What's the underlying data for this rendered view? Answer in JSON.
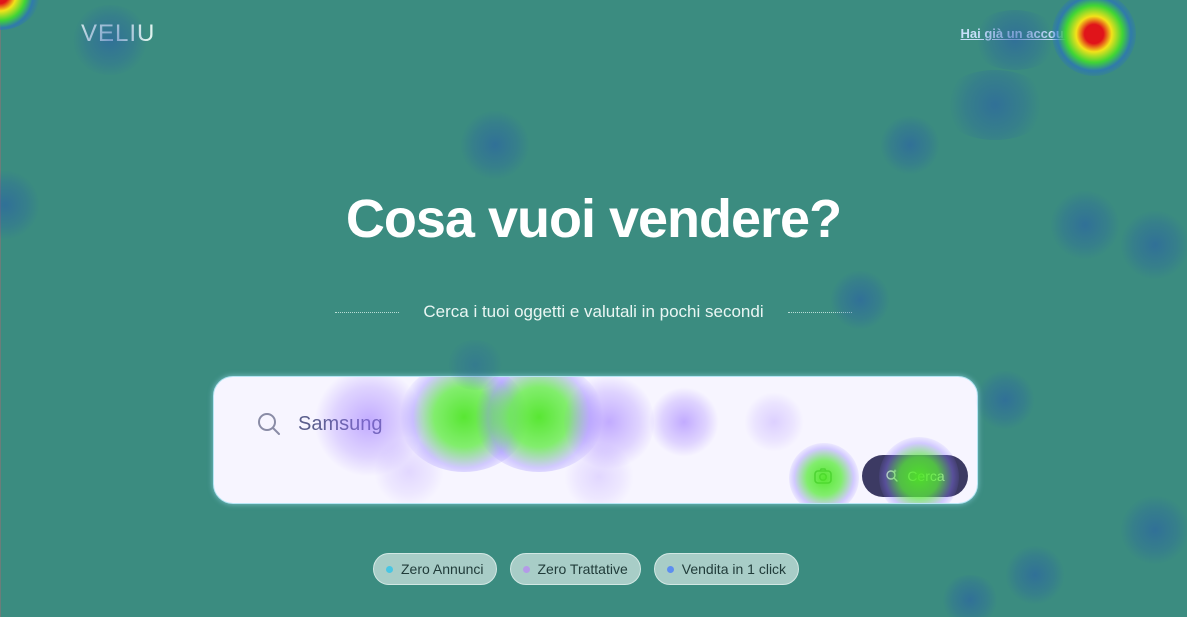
{
  "header": {
    "logo_text": "VELIU",
    "login_link": "Hai già un account?"
  },
  "hero": {
    "title": "Cosa vuoi vendere?",
    "subtitle": "Cerca i tuoi oggetti e valutali in pochi secondi"
  },
  "search": {
    "input_value": "Samsung",
    "search_icon": "search-icon",
    "camera_icon": "camera-icon",
    "button_label": "Cerca",
    "button_icon": "sparkle-search-icon"
  },
  "chips": [
    {
      "label": "Zero Annunci",
      "dot_color": "#49c6e3"
    },
    {
      "label": "Zero Trattative",
      "dot_color": "#b49ae8"
    },
    {
      "label": "Vendita in 1 click",
      "dot_color": "#5d8ef0"
    }
  ],
  "colors": {
    "background": "#3b8c80",
    "card": "#f7f5ff",
    "search_button": "#3c3a63"
  }
}
